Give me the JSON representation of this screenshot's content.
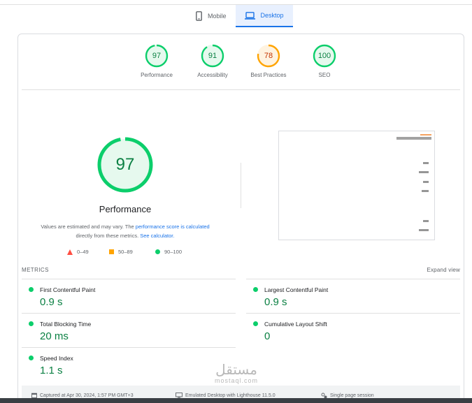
{
  "tabs": [
    {
      "label": "Mobile",
      "icon": "smartphone-icon",
      "active": false
    },
    {
      "label": "Desktop",
      "icon": "laptop-icon",
      "active": true
    }
  ],
  "categories": [
    {
      "score": "97",
      "label": "Performance",
      "value": 0.97,
      "color": "#0cce6b"
    },
    {
      "score": "91",
      "label": "Accessibility",
      "value": 0.91,
      "color": "#0cce6b"
    },
    {
      "score": "78",
      "label": "Best Practices",
      "value": 0.78,
      "color": "#ffa400"
    },
    {
      "score": "100",
      "label": "SEO",
      "value": 1.0,
      "color": "#0cce6b"
    }
  ],
  "performance": {
    "score": "97",
    "value": 0.97,
    "title": "Performance",
    "note_text": "Values are estimated and may vary. The ",
    "note_link1": "performance score is calculated",
    "note_mid": " directly from these metrics. ",
    "note_link2": "See calculator."
  },
  "legend": [
    {
      "range": "0–49",
      "shape": "triangle",
      "color": "#ff4e42"
    },
    {
      "range": "50–89",
      "shape": "square",
      "color": "#ffa400"
    },
    {
      "range": "90–100",
      "shape": "circle",
      "color": "#0cce6b"
    }
  ],
  "metrics": {
    "header": "METRICS",
    "expand_label": "Expand view",
    "items": [
      {
        "name": "First Contentful Paint",
        "value": "0.9 s"
      },
      {
        "name": "Largest Contentful Paint",
        "value": "0.9 s"
      },
      {
        "name": "Total Blocking Time",
        "value": "20 ms"
      },
      {
        "name": "Cumulative Layout Shift",
        "value": "0"
      },
      {
        "name": "Speed Index",
        "value": "1.1 s"
      }
    ]
  },
  "footer": {
    "captured": "Captured at Apr 30, 2024, 1:57 PM GMT+3",
    "emulated": "Emulated Desktop with Lighthouse 11.5.0",
    "session": "Single page session"
  },
  "watermark": {
    "line1": "مستقل",
    "line2": "mostaql.com"
  },
  "colors": {
    "pass": "#0cce6b",
    "average": "#ffa400",
    "fail": "#ff4e42",
    "accent": "#1a73e8"
  }
}
